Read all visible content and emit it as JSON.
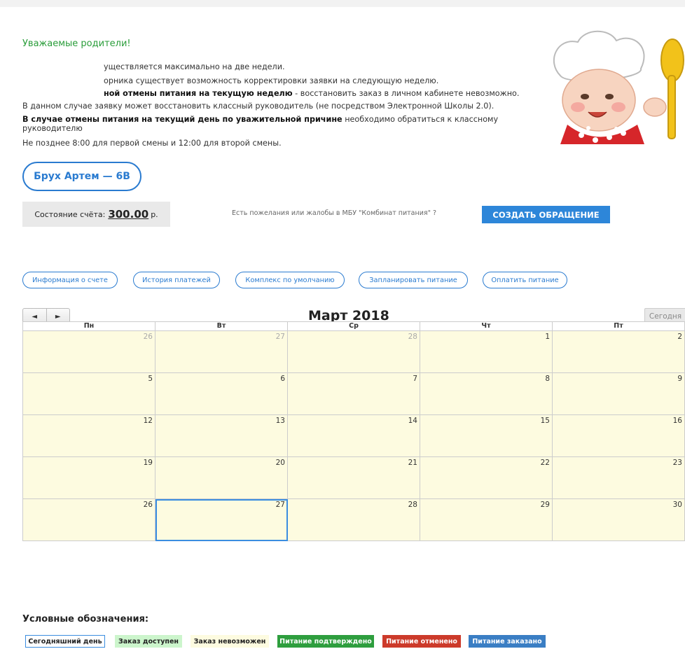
{
  "greeting": "Уважаемые родители!",
  "notice": {
    "line1": "уществляется максимально на две недели.",
    "line2": "орника существует возможность корректировки заявки на следующую неделю.",
    "line3_bold": "ной отмены питания на текущую неделю",
    "line3_rest": " - восстановить заказ в личном кабинете невозможно.",
    "line4": "В данном случае заявку может восстановить классный руководитель (не посредством Электронной Школы 2.0).",
    "line5_bold": "В случае отмены питания на текущий день по уважительной причине",
    "line5_rest": " необходимо обратиться к классному",
    "line5_cont": "руководителю",
    "line6": "Не позднее 8:00 для первой смены и 12:00 для второй смены."
  },
  "student": {
    "label": "Брух Артем — 6В"
  },
  "balance": {
    "label": "Состояние счёта:",
    "amount": "300.00",
    "currency": "р."
  },
  "complaint": {
    "text": "Есть пожелания или жалобы в МБУ \"Комбинат питания\" ?",
    "button": "СОЗДАТЬ ОБРАЩЕНИЕ"
  },
  "actions": [
    "Информация о счете",
    "История платежей",
    "Комплекс по умолчанию",
    "Запланировать питание",
    "Оплатить питание"
  ],
  "calendar": {
    "prev_icon": "◄",
    "next_icon": "►",
    "title": "Март 2018",
    "today_button": "Сегодня",
    "weekdays": [
      "Пн",
      "Вт",
      "Ср",
      "Чт",
      "Пт"
    ],
    "weeks": [
      [
        {
          "d": "26",
          "other": true
        },
        {
          "d": "27",
          "other": true
        },
        {
          "d": "28",
          "other": true
        },
        {
          "d": "1"
        },
        {
          "d": "2"
        }
      ],
      [
        {
          "d": "5"
        },
        {
          "d": "6"
        },
        {
          "d": "7"
        },
        {
          "d": "8"
        },
        {
          "d": "9"
        }
      ],
      [
        {
          "d": "12"
        },
        {
          "d": "13"
        },
        {
          "d": "14"
        },
        {
          "d": "15"
        },
        {
          "d": "16"
        }
      ],
      [
        {
          "d": "19"
        },
        {
          "d": "20"
        },
        {
          "d": "21"
        },
        {
          "d": "22"
        },
        {
          "d": "23"
        }
      ],
      [
        {
          "d": "26"
        },
        {
          "d": "27",
          "today": true
        },
        {
          "d": "28"
        },
        {
          "d": "29"
        },
        {
          "d": "30"
        }
      ]
    ]
  },
  "legend": {
    "title": "Условные обозначения:",
    "items": [
      {
        "label": "Сегодняшний день",
        "bg": "#ffffff",
        "fg": "#222222",
        "border": "#3b8de0"
      },
      {
        "label": "Заказ доступен",
        "bg": "#ccf5cc",
        "fg": "#222222"
      },
      {
        "label": "Заказ невозможен",
        "bg": "#fdfbe0",
        "fg": "#222222"
      },
      {
        "label": "Питание подтверждено",
        "bg": "#2e9e3e",
        "fg": "#ffffff"
      },
      {
        "label": "Питание отменено",
        "bg": "#cc3a2a",
        "fg": "#ffffff"
      },
      {
        "label": "Питание заказано",
        "bg": "#3a7ec4",
        "fg": "#ffffff"
      }
    ]
  },
  "colors": {
    "accent": "#2a7bd0",
    "green_text": "#2a9d3a",
    "calendar_cell": "#fdfbe0"
  }
}
